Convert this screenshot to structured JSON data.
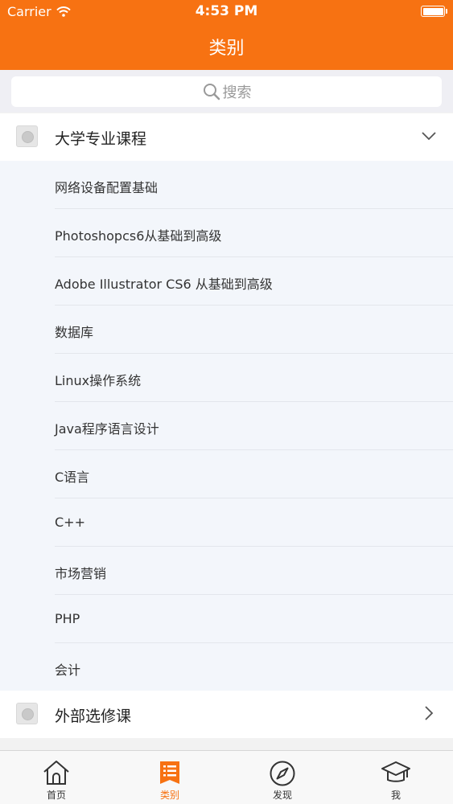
{
  "status_bar": {
    "carrier": "Carrier",
    "time": "4:53 PM"
  },
  "nav": {
    "title": "类别"
  },
  "search": {
    "placeholder": "搜索"
  },
  "groups": [
    {
      "label": "大学专业课程",
      "expanded": true
    },
    {
      "label": "外部选修课",
      "expanded": false
    }
  ],
  "sub_items": [
    "网络设备配置基础",
    "Photoshopcs6从基础到高级",
    "Adobe Illustrator CS6 从基础到高级",
    "数据库",
    "Linux操作系统",
    "Java程序语言设计",
    "C语言",
    "C++",
    "市场营销",
    "PHP",
    "会计"
  ],
  "tabs": [
    {
      "label": "首页",
      "icon": "home-icon",
      "active": false
    },
    {
      "label": "类别",
      "icon": "list-icon",
      "active": true
    },
    {
      "label": "发现",
      "icon": "compass-icon",
      "active": false
    },
    {
      "label": "我",
      "icon": "graduation-cap-icon",
      "active": false
    }
  ],
  "colors": {
    "accent": "#f77212",
    "list_bg": "#f3f6fb"
  }
}
